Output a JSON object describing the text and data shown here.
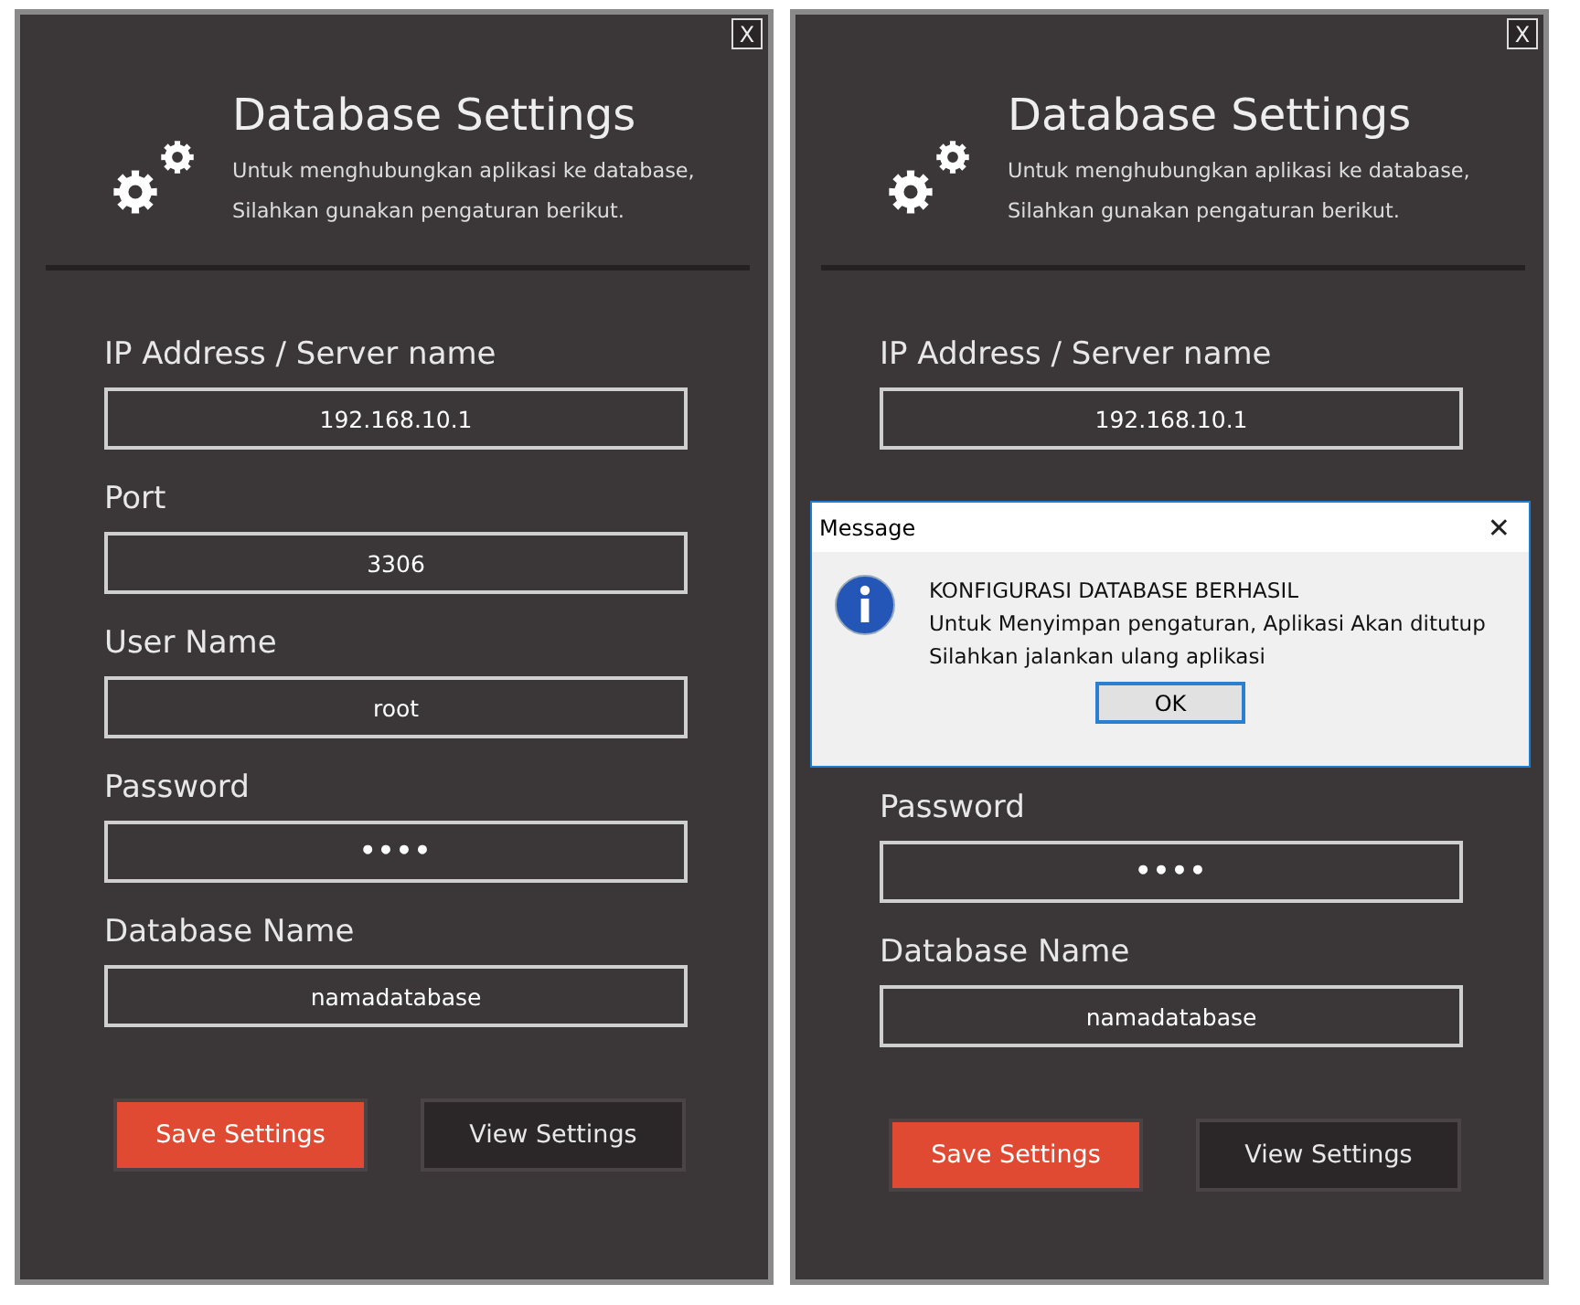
{
  "panels": [
    {
      "close": "X",
      "title": "Database Settings",
      "subtitle": [
        "Untuk menghubungkan aplikasi ke database,",
        "Silahkan gunakan pengaturan berikut."
      ],
      "fields": [
        {
          "label": "IP Address / Server name",
          "value": "192.168.10.1",
          "kind": "text"
        },
        {
          "label": "Port",
          "value": "3306",
          "kind": "text"
        },
        {
          "label": "User Name",
          "value": "root",
          "kind": "text"
        },
        {
          "label": "Password",
          "value": "••••",
          "kind": "password"
        },
        {
          "label": "Database Name",
          "value": "namadatabase",
          "kind": "text"
        }
      ],
      "buttons": [
        {
          "label": "Save Settings",
          "kind": "primary"
        },
        {
          "label": "View Settings",
          "kind": "secondary"
        }
      ]
    },
    {
      "close": "X",
      "title": "Database Settings",
      "subtitle": [
        "Untuk menghubungkan aplikasi ke database,",
        "Silahkan gunakan pengaturan berikut."
      ],
      "fields": [
        {
          "label": "IP Address / Server name",
          "value": "192.168.10.1",
          "kind": "text"
        },
        {
          "label": "Password",
          "value": "••••",
          "kind": "password"
        },
        {
          "label": "Database Name",
          "value": "namadatabase",
          "kind": "text"
        }
      ],
      "buttons": [
        {
          "label": "Save Settings",
          "kind": "primary"
        },
        {
          "label": "View Settings",
          "kind": "secondary"
        }
      ],
      "dialog": {
        "title": "Message",
        "close": "✕",
        "lines": [
          "KONFIGURASI DATABASE BERHASIL",
          "Untuk Menyimpan pengaturan, Aplikasi Akan ditutup",
          "Silahkan jalankan ulang aplikasi"
        ],
        "button": "OK"
      }
    }
  ]
}
